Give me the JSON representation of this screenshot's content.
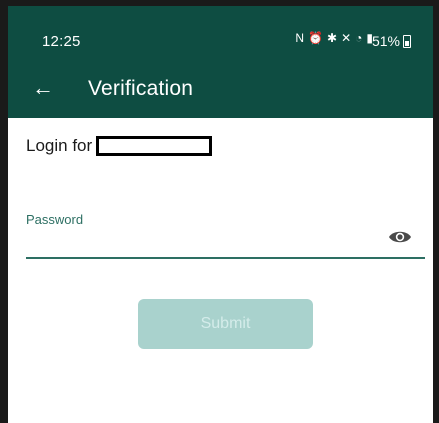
{
  "status_bar": {
    "time": "12:25",
    "battery": "51%",
    "icons": [
      "nfc-icon",
      "alarm-icon",
      "bluetooth-icon",
      "mute-icon",
      "wifi-icon",
      "signal-icon"
    ]
  },
  "app_bar": {
    "back_icon": "arrow-left-icon",
    "title": "Verification"
  },
  "login": {
    "label": "Login for"
  },
  "password": {
    "label": "Password",
    "value": "",
    "toggle_icon": "eye-icon"
  },
  "submit": {
    "label": "Submit",
    "enabled": false
  },
  "colors": {
    "primary": "#0e4d42",
    "accent": "#2d6f63",
    "button_disabled": "#a9d2cd"
  }
}
